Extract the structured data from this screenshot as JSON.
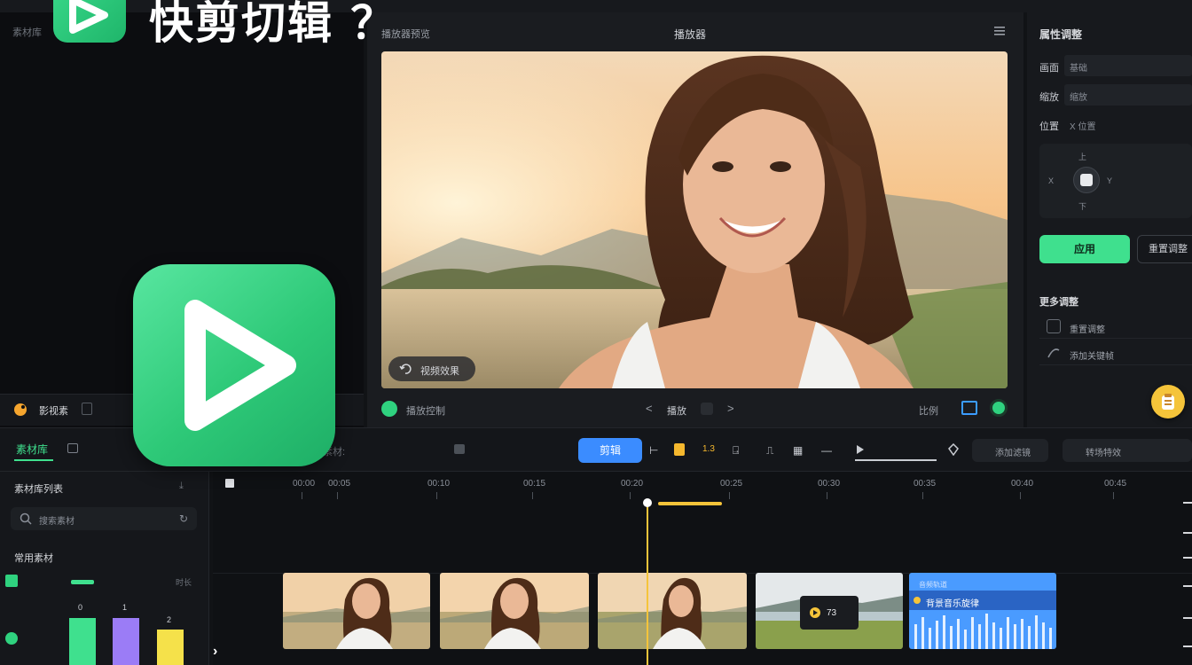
{
  "app": {
    "title": "快剪切辑 ？"
  },
  "media_panel": {
    "label": "素材库",
    "footer_label": "影视素"
  },
  "preview": {
    "header_left": "播放器预览",
    "header_center": "播放器",
    "effect_chip": "视频效果",
    "ctrl_left": "播放控制",
    "ctrl_prev": "<",
    "ctrl_time": "播放",
    "ctrl_next": ">",
    "ctrl_ratio": "比例"
  },
  "properties": {
    "title": "属性调整",
    "rows": [
      {
        "label": "画面",
        "value": "基础"
      },
      {
        "label": "缩放",
        "value": "缩放"
      },
      {
        "label": "位置",
        "value": "X 位置"
      }
    ],
    "pad": {
      "top": "上",
      "left": "X",
      "right": "Y",
      "bottom": "下"
    },
    "apply_label": "应用",
    "reset_label": "重置调整",
    "more_title": "更多调整",
    "more_items": [
      "重置调整",
      "添加关键帧"
    ]
  },
  "toolbar": {
    "tab1": "素材库",
    "text1": "素材:",
    "text2": "",
    "split_label": "剪辑",
    "tools": [
      "⊢",
      "",
      "1.3",
      "⍈",
      "⎍",
      "▦",
      "—"
    ],
    "btn_r1": "添加滤镜",
    "btn_r2": "转场特效"
  },
  "bottom_left": {
    "title": "素材库列表",
    "search_placeholder": "搜索素材",
    "sub_title": "常用素材",
    "bar_labels": [
      "0",
      "1",
      "2"
    ],
    "side_label": "时长"
  },
  "timeline": {
    "ruler_left": [
      "",
      ""
    ],
    "ticks": [
      "00:00",
      "00:05",
      "00:10",
      "00:15",
      "00:20",
      "00:25",
      "00:30",
      "00:35",
      "00:40",
      "00:45"
    ],
    "audio_label": "背景音乐旋律",
    "audio_top": "音频轨道",
    "overlay_text": "73"
  },
  "colors": {
    "accent_green": "#3fe08e",
    "accent_blue": "#3b8cff",
    "accent_yellow": "#f5c43a"
  }
}
